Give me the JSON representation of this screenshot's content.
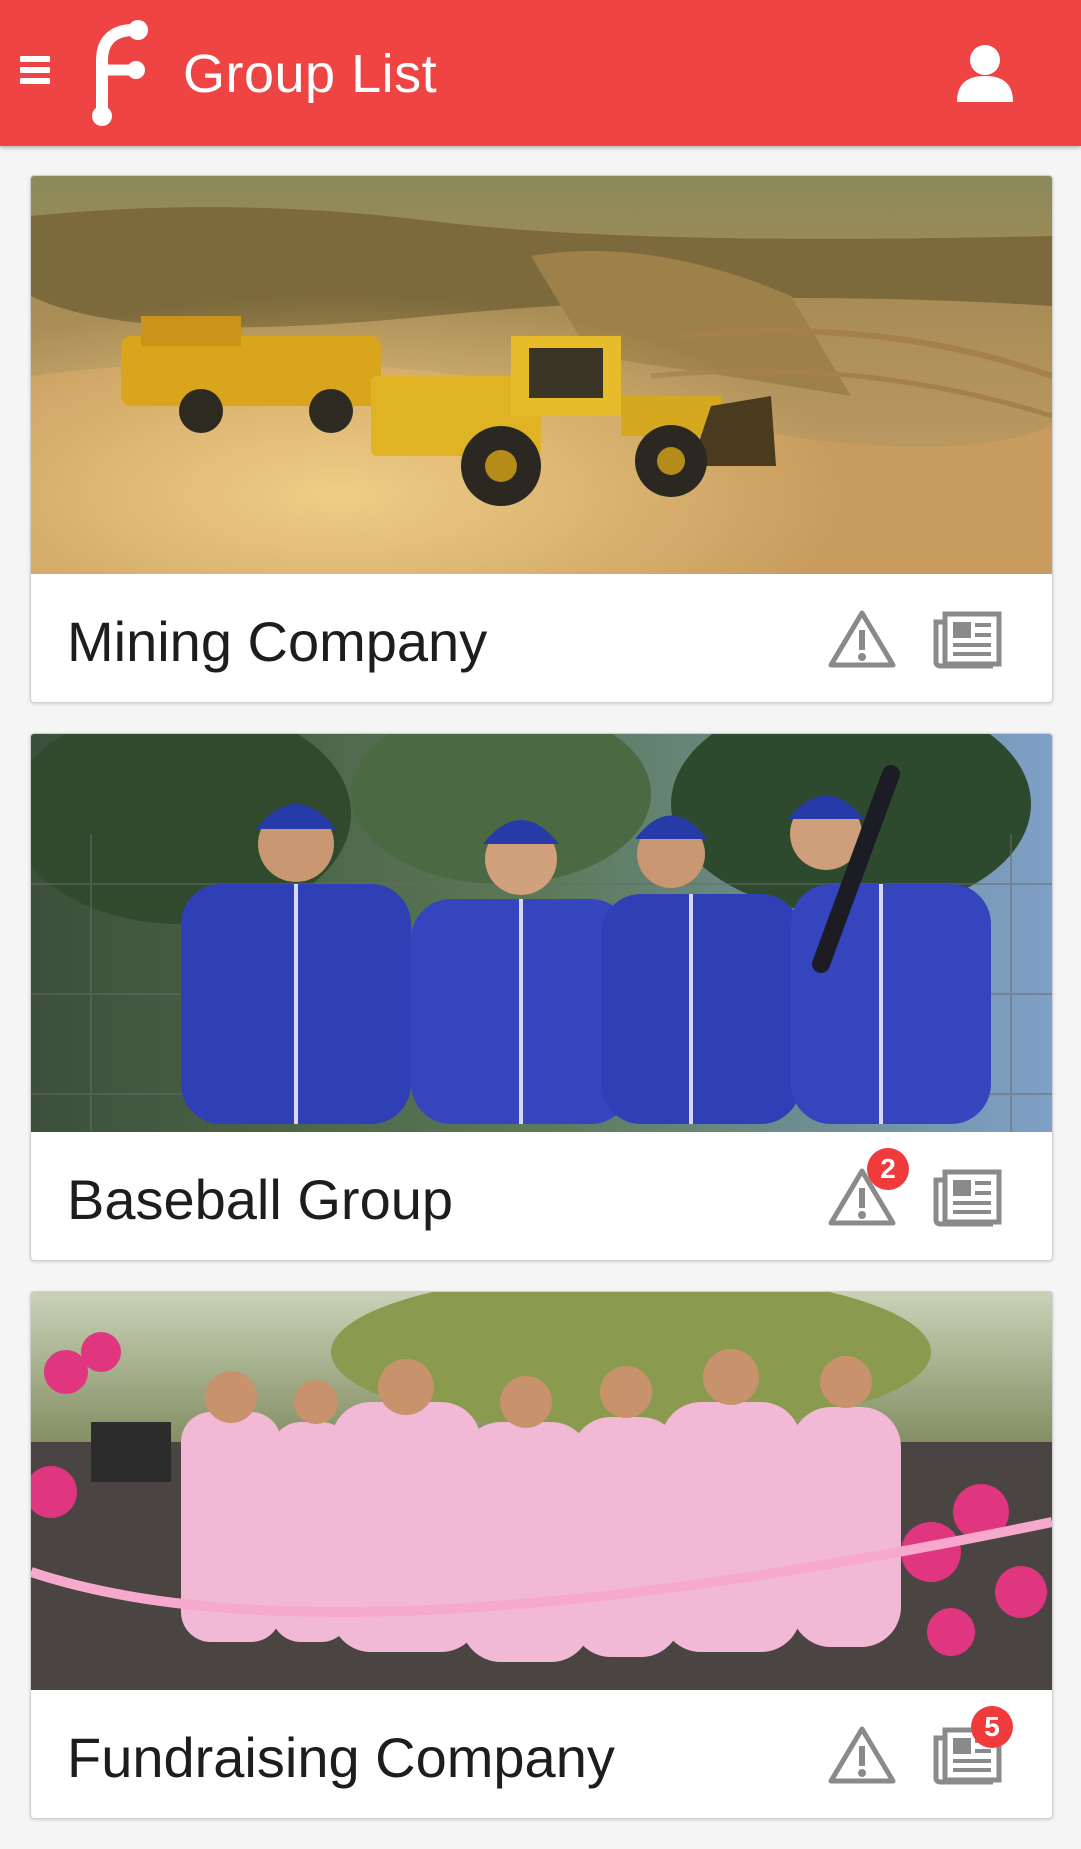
{
  "appbar": {
    "title": "Group List",
    "menu_icon": "hamburger-menu-icon",
    "logo": "app-logo",
    "profile_icon": "user-profile-icon",
    "color": "#ef4444"
  },
  "groups": [
    {
      "name": "Mining Company",
      "image": "mining-site-photo",
      "alerts_badge": "",
      "news_badge": ""
    },
    {
      "name": "Baseball Group",
      "image": "baseball-team-photo",
      "alerts_badge": "2",
      "news_badge": ""
    },
    {
      "name": "Fundraising Company",
      "image": "charity-run-photo",
      "alerts_badge": "",
      "news_badge": "5"
    }
  ],
  "icons": {
    "alert": "warning-triangle-icon",
    "news": "newspaper-icon"
  },
  "colors": {
    "badge": "#ef3b3b",
    "icon_gray": "#8a8a8a"
  }
}
